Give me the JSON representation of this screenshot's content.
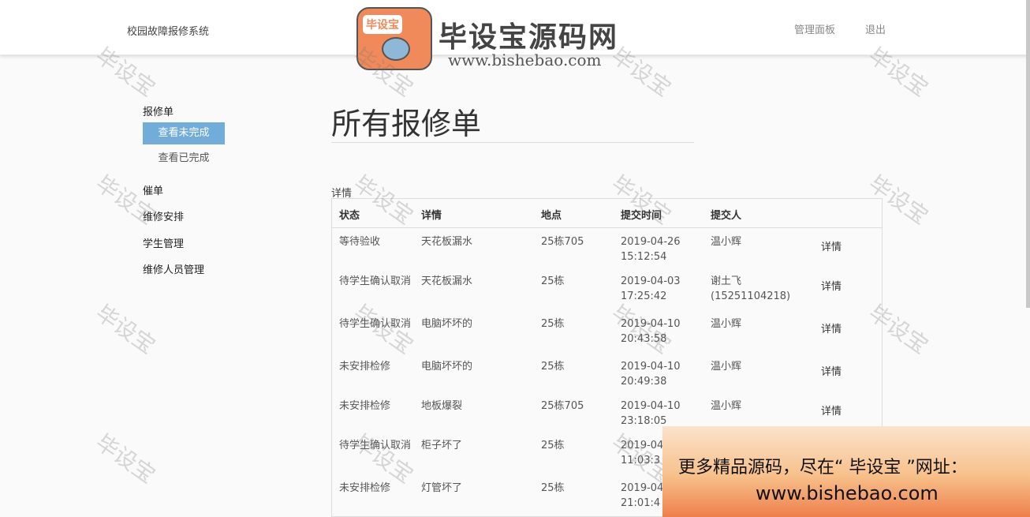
{
  "header": {
    "brand": "校园故障报修系统",
    "nav": {
      "dashboard": "管理面板",
      "logout": "退出"
    }
  },
  "logo": {
    "badge": "毕设宝",
    "title": "毕设宝源码网",
    "url": "www.bishebao.com"
  },
  "sidebar": {
    "group_repair": "报修单",
    "sub_unfinished": "查看未完成",
    "sub_finished": "查看已完成",
    "urge": "催单",
    "arrange": "维修安排",
    "students": "学生管理",
    "workers": "维修人员管理"
  },
  "main": {
    "title": "所有报修单",
    "caption": "详情",
    "columns": [
      "状态",
      "详情",
      "地点",
      "提交时间",
      "提交人"
    ],
    "rows": [
      {
        "status": "等待验收",
        "detail": "天花板漏水",
        "location": "25栋705",
        "time": "2019-04-26 15:12:54",
        "user": "温小辉",
        "action": "详情"
      },
      {
        "status": "待学生确认取消",
        "detail": "天花板漏水",
        "location": "25栋",
        "time": "2019-04-03 17:25:42",
        "user": "谢土飞 (15251104218)",
        "action": "详情"
      },
      {
        "status": "待学生确认取消",
        "detail": "电脑坏坏的",
        "location": "25栋",
        "time": "2019-04-10 20:43:58",
        "user": "温小辉",
        "action": "详情"
      },
      {
        "status": "未安排检修",
        "detail": "电脑坏坏的",
        "location": "25栋",
        "time": "2019-04-10 20:49:38",
        "user": "温小辉",
        "action": "详情"
      },
      {
        "status": "未安排检修",
        "detail": "地板爆裂",
        "location": "25栋705",
        "time": "2019-04-10 23:18:05",
        "user": "温小辉",
        "action": "详情"
      },
      {
        "status": "待学生确认取消",
        "detail": "柜子坏了",
        "location": "25栋",
        "time": "2019-04 11:03:3",
        "user": "",
        "action": ""
      },
      {
        "status": "未安排检修",
        "detail": "灯管坏了",
        "location": "25栋",
        "time": "2019-04 21:01:4",
        "user": "",
        "action": ""
      }
    ]
  },
  "watermark": "毕设宝",
  "ad": {
    "line1": "更多精品源码，尽在“ 毕设宝 ”网址：",
    "line2": "www.bishebao.com"
  }
}
